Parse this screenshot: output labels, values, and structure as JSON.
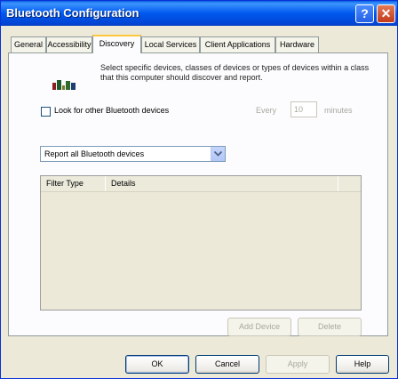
{
  "window": {
    "title": "Bluetooth Configuration",
    "help": "?",
    "close": "✕"
  },
  "tabs": [
    {
      "label": "General"
    },
    {
      "label": "Accessibility"
    },
    {
      "label": "Discovery"
    },
    {
      "label": "Local Services"
    },
    {
      "label": "Client Applications"
    },
    {
      "label": "Hardware"
    }
  ],
  "discovery": {
    "description": "Select specific devices, classes of devices or types of devices within a class that this computer should discover and report.",
    "look_for_others": {
      "label": "Look for other Bluetooth devices",
      "checked": false
    },
    "every_label": "Every",
    "interval_value": "10",
    "minutes_label": "minutes",
    "report_select": {
      "value": "Report all Bluetooth devices"
    },
    "filter_list": {
      "columns": [
        "Filter Type",
        "Details"
      ]
    },
    "add_device": "Add Device",
    "delete": "Delete"
  },
  "footer": {
    "ok": "OK",
    "cancel": "Cancel",
    "apply": "Apply",
    "help": "Help"
  },
  "colors": {
    "titlebar": "#0058EE",
    "dialog_bg": "#ECE9D8",
    "active_tab_accent": "#FFC83C"
  }
}
